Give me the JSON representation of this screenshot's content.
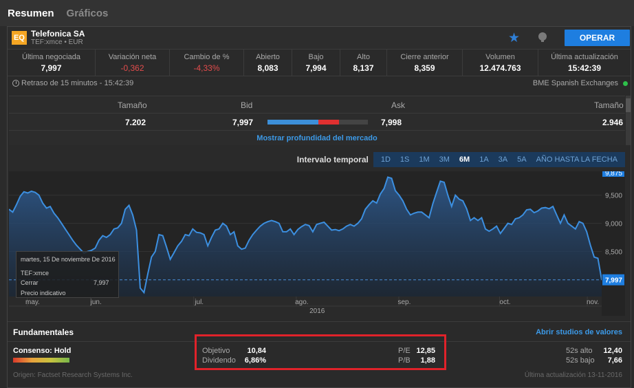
{
  "tabs": [
    {
      "label": "Resumen"
    },
    {
      "label": "Gráficos"
    }
  ],
  "header": {
    "badge": "EQ",
    "company": "Telefonica SA",
    "ticker": "TEF:xmce • EUR",
    "operar_label": "OPERAR",
    "accent": "#1e7ee0"
  },
  "stats": [
    {
      "label": "Última negociada",
      "value": "7,997"
    },
    {
      "label": "Variación neta",
      "value": "-0,362"
    },
    {
      "label": "Cambio de %",
      "value": "-4,33%"
    },
    {
      "label": "Abierto",
      "value": "8,083"
    },
    {
      "label": "Bajo",
      "value": "7,994"
    },
    {
      "label": "Alto",
      "value": "8,137"
    },
    {
      "label": "Cierre anterior",
      "value": "8,359"
    },
    {
      "label": "Volumen",
      "value": "12.474.763"
    },
    {
      "label": "Última actualización",
      "value": "15:42:39"
    }
  ],
  "delay": {
    "text": "Retraso de 15 minutos - 15:42:39",
    "exchange": "BME Spanish Exchanges"
  },
  "book": {
    "headers": {
      "size_bid": "Tamaño",
      "bid": "Bid",
      "ask": "Ask",
      "size_ask": "Tamaño"
    },
    "values": {
      "size_bid": "7.202",
      "bid": "7,997",
      "ask": "7,998",
      "size_ask": "2.946"
    },
    "depth_link": "Mostrar profundidad del mercado"
  },
  "interval": {
    "label": "Intervalo temporal",
    "options": [
      "1D",
      "1S",
      "1M",
      "3M",
      "6M",
      "1A",
      "3A",
      "5A",
      "AÑO HASTA LA FECHA"
    ],
    "selected": "6M"
  },
  "chart_data": {
    "type": "area",
    "ylim": [
      7700,
      9900
    ],
    "yticks": [
      "9,500",
      "9,000",
      "8,500"
    ],
    "top_tick": "9,875",
    "months": [
      "may.",
      "jun.",
      "jul.",
      "ago.",
      "sep.",
      "oct.",
      "nov."
    ],
    "year": "2016",
    "last_value": "7,997",
    "line_color": "#3c8fe0",
    "series": [
      {
        "values": [
          9250,
          9200,
          9330,
          9480,
          9560,
          9540,
          9570,
          9550,
          9500,
          9360,
          9270,
          9300,
          9180,
          9100,
          9000,
          8900,
          8800,
          8700,
          8610,
          8540,
          8470,
          8500,
          8520,
          8560,
          8700,
          8780,
          8750,
          8800,
          8900,
          8920,
          9000,
          9250,
          9320,
          9150,
          8880,
          7850,
          7770,
          8100,
          8400,
          8500,
          8800,
          8780,
          8580,
          8360,
          8480,
          8600,
          8680,
          8800,
          8780,
          8900,
          8840,
          8830,
          8800,
          8600,
          8750,
          8880,
          8900,
          9000,
          8950,
          8800,
          8850,
          8600,
          8540,
          8560,
          8700,
          8800,
          8880,
          8950,
          9000,
          9030,
          9050,
          9030,
          9000,
          8850,
          8850,
          8900,
          8800,
          8890,
          8940,
          8980,
          8960,
          8850,
          8980,
          9000,
          9020,
          8950,
          8880,
          8890,
          8870,
          8900,
          8950,
          8980,
          8950,
          9000,
          9080,
          9250,
          9330,
          9400,
          9360,
          9520,
          9620,
          9820,
          9800,
          9580,
          9500,
          9400,
          9250,
          9150,
          9180,
          9200,
          9200,
          9150,
          9100,
          9350,
          9550,
          9750,
          9730,
          9500,
          9300,
          9500,
          9430,
          9400,
          9260,
          9050,
          9100,
          9050,
          9100,
          8900,
          8860,
          8900,
          8950,
          8820,
          8910,
          9000,
          8980,
          9080,
          9100,
          9150,
          9240,
          9250,
          9190,
          9220,
          9270,
          9280,
          9260,
          9300,
          9150,
          9000,
          9150,
          9000,
          8950,
          8900,
          9030,
          9000,
          8850,
          8610,
          8400,
          8380,
          7997
        ]
      }
    ]
  },
  "tooltip": {
    "date": "martes, 15 De noviembre De 2016",
    "symbol": "TEF:xmce",
    "close_label": "Cerrar",
    "close_value": "7,997",
    "note": "Precio indicativo"
  },
  "fund": {
    "title": "Fundamentales",
    "link": "Abrir studios de valores",
    "consenso": "Consenso: Hold",
    "objetivo_label": "Objetivo",
    "objetivo": "10,84",
    "dividendo_label": "Dividendo",
    "dividendo": "6,86%",
    "pe_label": "P/E",
    "pe": "12,85",
    "pb_label": "P/B",
    "pb": "1,88",
    "high_label": "52s alto",
    "high": "12,40",
    "low_label": "52s bajo",
    "low": "7,66",
    "source": "Origen: Factset Research Systems Inc.",
    "updated": "Última actualización 13-11-2016"
  }
}
